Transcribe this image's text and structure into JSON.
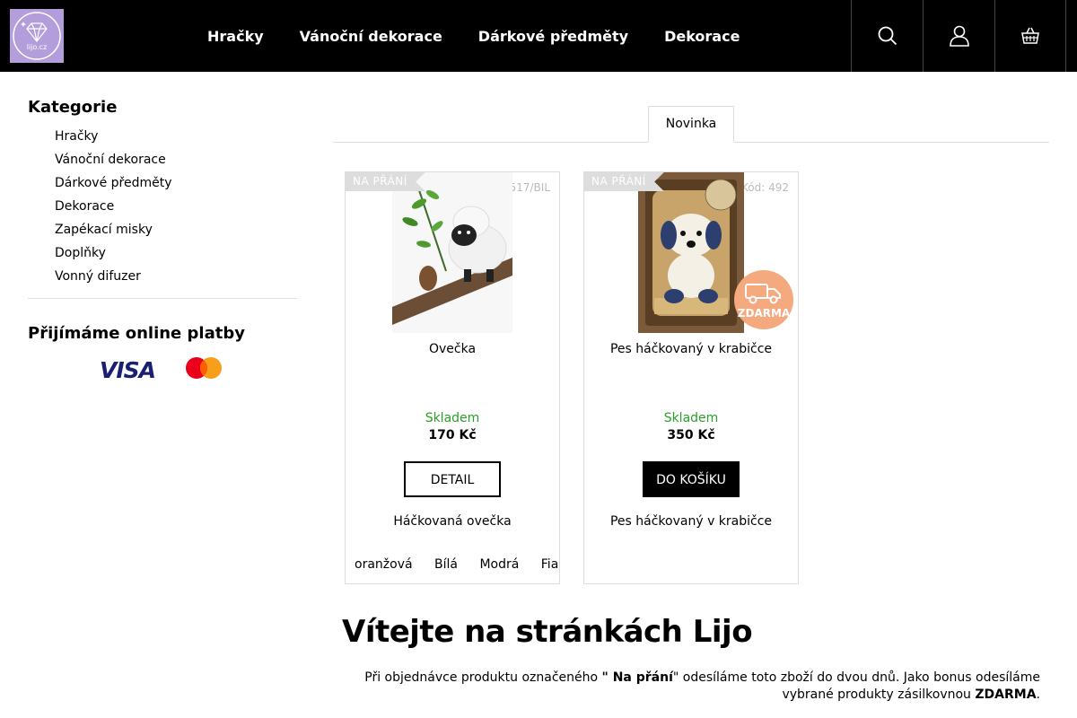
{
  "logo": {
    "text": "lijo.cz"
  },
  "nav": {
    "items": [
      "Hračky",
      "Vánoční dekorace",
      "Dárkové předměty",
      "Dekorace"
    ]
  },
  "header_icons": [
    "search-icon",
    "user-icon",
    "basket-icon"
  ],
  "sidebar": {
    "title": "Kategorie",
    "items": [
      "Hračky",
      "Vánoční dekorace",
      "Dárkové předměty",
      "Dekorace",
      "Zapékací misky",
      "Doplňky",
      "Vonný difuzer"
    ],
    "payments_title": "Přijímáme online platby",
    "visa": "VISA"
  },
  "tabs": {
    "active": "Novinka"
  },
  "products": [
    {
      "ribbon": "NA PŘÁNÍ",
      "code": "517/BIL",
      "name": "Ovečka",
      "stock": "Skladem",
      "price": "170 Kč",
      "button": "DETAIL",
      "description": "Háčkovaná ovečka",
      "variants": [
        "oranžová",
        "Bílá",
        "Modrá",
        "Fialová"
      ]
    },
    {
      "ribbon": "NA PŘÁNÍ",
      "code": "Kód: 492",
      "name": "Pes háčkovaný v krabičce",
      "stock": "Skladem",
      "price": "350 Kč",
      "button": "DO KOŠÍKU",
      "description": "Pes háčkovaný v krabičce",
      "badge": "ZDARMA"
    }
  ],
  "welcome": {
    "title": "Vítejte na stránkách Lijo",
    "text_1": "Při objednávce produktu označeného ",
    "text_bold": "\" Na přání",
    "text_2": "\" odesíláme toto zboží do dvou dnů. Jako bonus odesíláme vybrané produkty  zásilkovnou ",
    "text_bold_2": "ZDARMA",
    "text_3": "."
  },
  "colors": {
    "header_bg": "#000000",
    "logo_bg": "#b39ddb",
    "stock_green": "#2a9d2a",
    "free_badge": "#f5a97f",
    "visa_blue": "#1a1f71"
  }
}
